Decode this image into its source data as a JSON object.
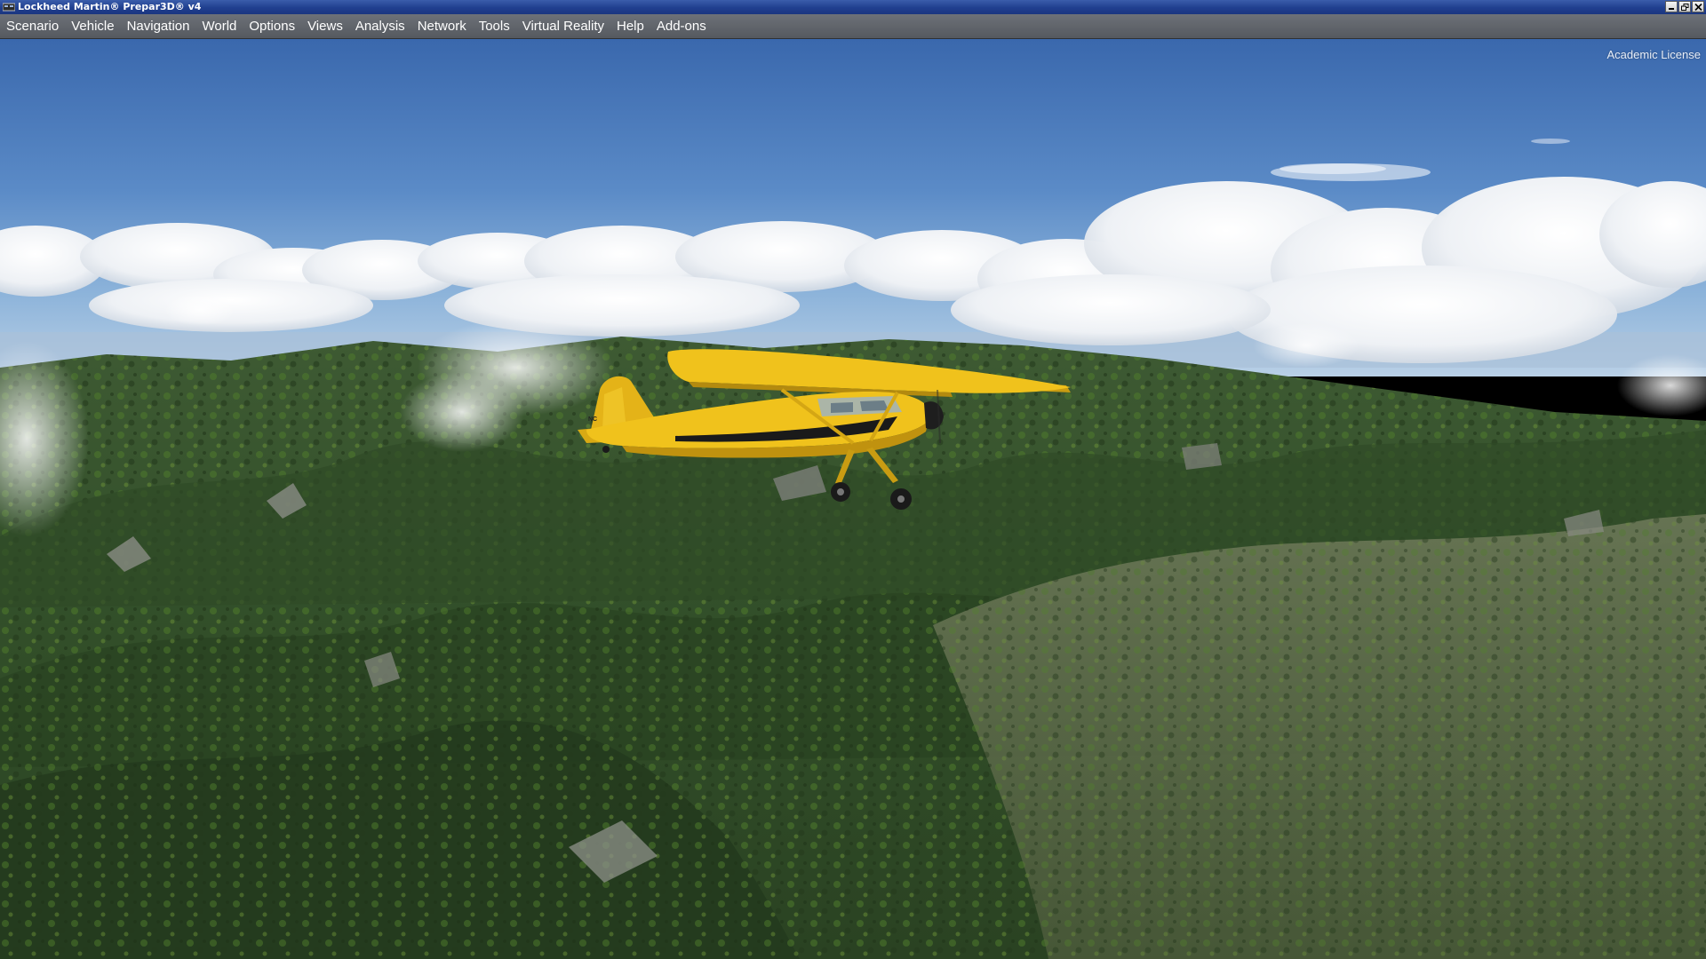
{
  "window": {
    "title": "Lockheed Martin® Prepar3D® v4",
    "icon": "p3d-app-icon",
    "controls": [
      "minimize-icon",
      "restore-icon",
      "close-icon"
    ]
  },
  "menubar": {
    "items": [
      {
        "label": "Scenario"
      },
      {
        "label": "Vehicle"
      },
      {
        "label": "Navigation"
      },
      {
        "label": "World"
      },
      {
        "label": "Options"
      },
      {
        "label": "Views"
      },
      {
        "label": "Analysis"
      },
      {
        "label": "Network"
      },
      {
        "label": "Tools"
      },
      {
        "label": "Virtual Reality"
      },
      {
        "label": "Help"
      },
      {
        "label": "Add-ons"
      }
    ]
  },
  "viewport": {
    "license_label": "Academic License",
    "aircraft_registration": "NC"
  },
  "colors": {
    "titlebar": "#203f8f",
    "menubar": "#5f636a",
    "sky_top": "#3f6fb3",
    "sky_horizon": "#a8c4de",
    "terrain": "#35502a",
    "aircraft": "#e8b81a"
  }
}
